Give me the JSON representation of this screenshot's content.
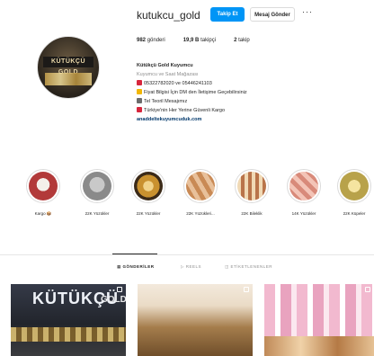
{
  "profile": {
    "username": "kutukcu_gold",
    "follow_label": "Takip Et",
    "message_label": "Mesaj Gönder",
    "more_label": "···",
    "avatar_text": "KÜTÜKÇÜ GOLD"
  },
  "stats": {
    "posts_count": "982",
    "posts_label": "gönderi",
    "followers_count": "19,9 B",
    "followers_label": "takipçi",
    "following_count": "2",
    "following_label": "takip"
  },
  "bio": {
    "name": "Kütükçü Gold Kuyumcu",
    "category": "Kuyumcu ve Saat Mağazası",
    "phone": "05322782020 ve 05446241103",
    "line_prices": "Fiyat Bilgisi İçin DM den İletişime Geçebilirsiniz",
    "line_mail": "Tel Teoril Mesajımız",
    "line_shipping": "Türkiye'nin Her Yerine Güvenli Kargo",
    "link": "anaddeltekuyumcuduk.com"
  },
  "highlights": [
    {
      "label": "Kargo 📦",
      "color": "#b23a3a"
    },
    {
      "label": "22K Yüzükler",
      "color": "#8a8a8a"
    },
    {
      "label": "22K Yüzükler",
      "color": "#c9912f"
    },
    {
      "label": "22K Yüzükleri...",
      "color": "#c98a55"
    },
    {
      "label": "22K Bileklik",
      "color": "#b9744a"
    },
    {
      "label": "14K Yüzükler",
      "color": "#d88a7a"
    },
    {
      "label": "22K Küpeler",
      "color": "#b8a24a"
    }
  ],
  "tabs": {
    "posts": "GÖNDERİLER",
    "reels": "REELS",
    "tagged": "ETİKETLENENLER"
  },
  "posts": [
    {
      "sign_text": "KÜTÜKÇÜ",
      "sign_text2": "GOLD"
    },
    {},
    {}
  ]
}
